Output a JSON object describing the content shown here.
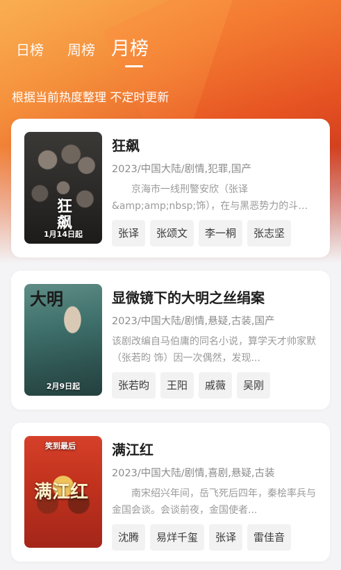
{
  "tabs": [
    {
      "label": "日榜",
      "active": false
    },
    {
      "label": "周榜",
      "active": false
    },
    {
      "label": "月榜",
      "active": true
    }
  ],
  "subtitle": "根据当前热度整理 不定时更新",
  "items": [
    {
      "title": "狂飙",
      "meta": "2023/中国大陆/剧情,犯罪,国产",
      "description": "　　京海市一线刑警安欣（张译&amp;amp;nbsp;饰），在与黑恶势力的斗争中...",
      "poster": {
        "title_text": "狂飙",
        "date": "1月14日起"
      },
      "cast": [
        "张译",
        "张颂文",
        "李一桐",
        "张志坚"
      ]
    },
    {
      "title": "显微镜下的大明之丝绢案",
      "meta": "2023/中国大陆/剧情,悬疑,古装,国产",
      "description": "该剧改编自马伯庸的同名小说，算学天才帅家默（张若昀 饰）因一次偶然，发现...",
      "poster": {
        "title_text": "大明",
        "date": "2月9日起"
      },
      "cast": [
        "张若昀",
        "王阳",
        "戚薇",
        "吴刚"
      ]
    },
    {
      "title": "满江红",
      "meta": "2023/中国大陆/剧情,喜剧,悬疑,古装",
      "description": "　　南宋绍兴年间，岳飞死后四年，秦桧率兵与金国会谈。会谈前夜，金国使者...",
      "poster": {
        "title_text": "满江红",
        "date": "",
        "tagline": "笑到最后"
      },
      "cast": [
        "沈腾",
        "易烊千玺",
        "张译",
        "雷佳音"
      ]
    }
  ]
}
